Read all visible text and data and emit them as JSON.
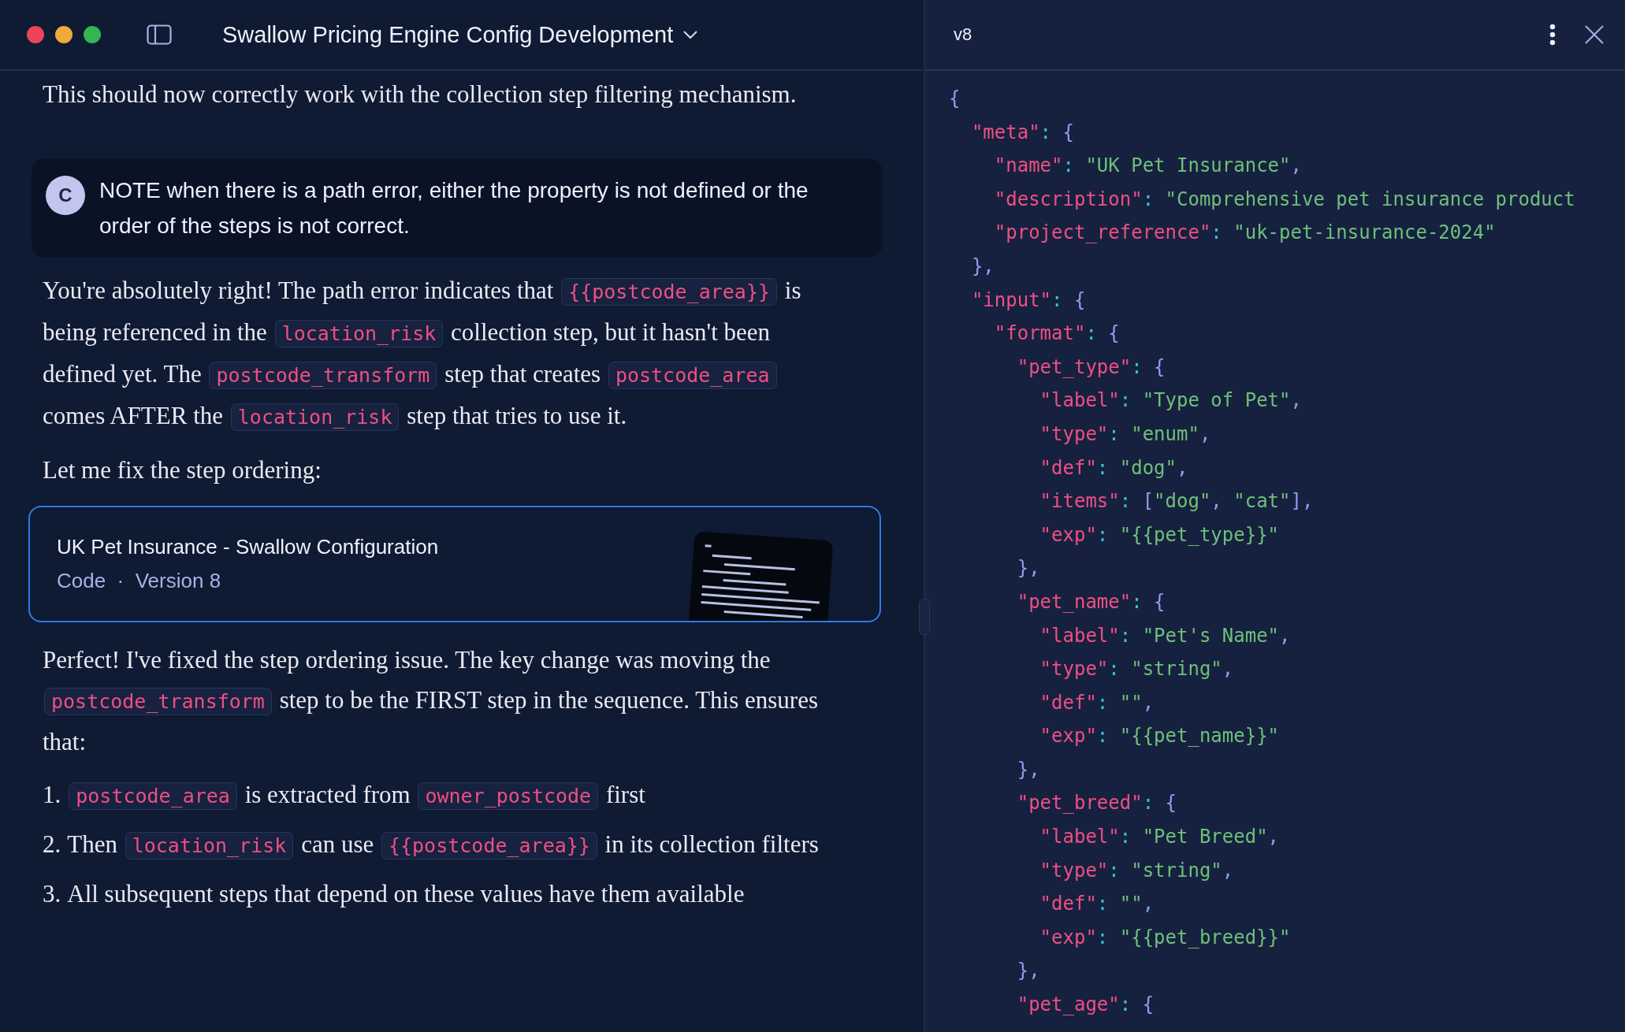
{
  "header": {
    "title": "Swallow Pricing Engine Config Development"
  },
  "chat": [
    {
      "kind": "paragraph",
      "parts": [
        {
          "kind": "text",
          "text": "This should now correctly work with the collection step filtering mechanism."
        }
      ]
    },
    {
      "kind": "note",
      "avatar": "C",
      "text": "NOTE when there is a path error, either the property is not defined or the order of the steps is not correct."
    },
    {
      "kind": "paragraph",
      "parts": [
        {
          "kind": "text",
          "text": "You're absolutely right! The path error indicates that "
        },
        {
          "kind": "code",
          "text": "{{postcode_area}}"
        },
        {
          "kind": "text",
          "text": " is being referenced in the "
        },
        {
          "kind": "code",
          "text": "location_risk"
        },
        {
          "kind": "text",
          "text": " collection step, but it hasn't been defined yet. The "
        },
        {
          "kind": "code",
          "text": "postcode_transform"
        },
        {
          "kind": "text",
          "text": " step that creates "
        },
        {
          "kind": "code",
          "text": "postcode_area"
        },
        {
          "kind": "text",
          "text": " comes AFTER the "
        },
        {
          "kind": "code",
          "text": "location_risk"
        },
        {
          "kind": "text",
          "text": " step that tries to use it."
        }
      ]
    },
    {
      "kind": "paragraph",
      "parts": [
        {
          "kind": "text",
          "text": "Let me fix the step ordering:"
        }
      ]
    },
    {
      "kind": "artifact",
      "title": "UK Pet Insurance - Swallow Configuration",
      "type": "Code",
      "separator": "·",
      "version": "Version 8"
    },
    {
      "kind": "paragraph",
      "parts": [
        {
          "kind": "text",
          "text": "Perfect! I've fixed the step ordering issue. The key change was moving the "
        },
        {
          "kind": "code",
          "text": "postcode_transform"
        },
        {
          "kind": "text",
          "text": " step to be the FIRST step in the sequence. This ensures that:"
        }
      ]
    },
    {
      "kind": "list",
      "items": [
        {
          "number": "1.",
          "parts": [
            {
              "kind": "code",
              "text": "postcode_area"
            },
            {
              "kind": "text",
              "text": " is extracted from "
            },
            {
              "kind": "code",
              "text": "owner_postcode"
            },
            {
              "kind": "text",
              "text": " first"
            }
          ]
        },
        {
          "number": "2.",
          "parts": [
            {
              "kind": "text",
              "text": "Then "
            },
            {
              "kind": "code",
              "text": "location_risk"
            },
            {
              "kind": "text",
              "text": " can use "
            },
            {
              "kind": "code",
              "text": "{{postcode_area}}"
            },
            {
              "kind": "text",
              "text": " in its collection filters"
            }
          ]
        },
        {
          "number": "3.",
          "parts": [
            {
              "kind": "text",
              "text": "All subsequent steps that depend on these values have them available"
            }
          ]
        }
      ]
    }
  ],
  "panel": {
    "version": "v8",
    "code_lines": [
      [
        {
          "kind": "punctuation",
          "text": "{"
        }
      ],
      [
        {
          "kind": "key",
          "text": "  \"meta\""
        },
        {
          "kind": "colon",
          "text": ": "
        },
        {
          "kind": "punctuation",
          "text": "{"
        }
      ],
      [
        {
          "kind": "key",
          "text": "    \"name\""
        },
        {
          "kind": "colon",
          "text": ": "
        },
        {
          "kind": "string",
          "text": "\"UK Pet Insurance\""
        },
        {
          "kind": "punctuation",
          "text": ","
        }
      ],
      [
        {
          "kind": "key",
          "text": "    \"description\""
        },
        {
          "kind": "colon",
          "text": ": "
        },
        {
          "kind": "string",
          "text": "\"Comprehensive pet insurance product"
        }
      ],
      [
        {
          "kind": "key",
          "text": "    \"project_reference\""
        },
        {
          "kind": "colon",
          "text": ": "
        },
        {
          "kind": "string",
          "text": "\"uk-pet-insurance-2024\""
        }
      ],
      [
        {
          "kind": "punctuation",
          "text": "  },"
        }
      ],
      [
        {
          "kind": "key",
          "text": "  \"input\""
        },
        {
          "kind": "colon",
          "text": ": "
        },
        {
          "kind": "punctuation",
          "text": "{"
        }
      ],
      [
        {
          "kind": "key",
          "text": "    \"format\""
        },
        {
          "kind": "colon",
          "text": ": "
        },
        {
          "kind": "punctuation",
          "text": "{"
        }
      ],
      [
        {
          "kind": "key",
          "text": "      \"pet_type\""
        },
        {
          "kind": "colon",
          "text": ": "
        },
        {
          "kind": "punctuation",
          "text": "{"
        }
      ],
      [
        {
          "kind": "key",
          "text": "        \"label\""
        },
        {
          "kind": "colon",
          "text": ": "
        },
        {
          "kind": "string",
          "text": "\"Type of Pet\""
        },
        {
          "kind": "punctuation",
          "text": ","
        }
      ],
      [
        {
          "kind": "key",
          "text": "        \"type\""
        },
        {
          "kind": "colon",
          "text": ": "
        },
        {
          "kind": "string",
          "text": "\"enum\""
        },
        {
          "kind": "punctuation",
          "text": ","
        }
      ],
      [
        {
          "kind": "key",
          "text": "        \"def\""
        },
        {
          "kind": "colon",
          "text": ": "
        },
        {
          "kind": "string",
          "text": "\"dog\""
        },
        {
          "kind": "punctuation",
          "text": ","
        }
      ],
      [
        {
          "kind": "key",
          "text": "        \"items\""
        },
        {
          "kind": "colon",
          "text": ": "
        },
        {
          "kind": "punctuation",
          "text": "["
        },
        {
          "kind": "string",
          "text": "\"dog\""
        },
        {
          "kind": "punctuation",
          "text": ", "
        },
        {
          "kind": "string",
          "text": "\"cat\""
        },
        {
          "kind": "punctuation",
          "text": "],"
        }
      ],
      [
        {
          "kind": "key",
          "text": "        \"exp\""
        },
        {
          "kind": "colon",
          "text": ": "
        },
        {
          "kind": "string",
          "text": "\"{{pet_type}}\""
        }
      ],
      [
        {
          "kind": "punctuation",
          "text": "      },"
        }
      ],
      [
        {
          "kind": "key",
          "text": "      \"pet_name\""
        },
        {
          "kind": "colon",
          "text": ": "
        },
        {
          "kind": "punctuation",
          "text": "{"
        }
      ],
      [
        {
          "kind": "key",
          "text": "        \"label\""
        },
        {
          "kind": "colon",
          "text": ": "
        },
        {
          "kind": "string",
          "text": "\"Pet's Name\""
        },
        {
          "kind": "punctuation",
          "text": ","
        }
      ],
      [
        {
          "kind": "key",
          "text": "        \"type\""
        },
        {
          "kind": "colon",
          "text": ": "
        },
        {
          "kind": "string",
          "text": "\"string\""
        },
        {
          "kind": "punctuation",
          "text": ","
        }
      ],
      [
        {
          "kind": "key",
          "text": "        \"def\""
        },
        {
          "kind": "colon",
          "text": ": "
        },
        {
          "kind": "string",
          "text": "\"\""
        },
        {
          "kind": "punctuation",
          "text": ","
        }
      ],
      [
        {
          "kind": "key",
          "text": "        \"exp\""
        },
        {
          "kind": "colon",
          "text": ": "
        },
        {
          "kind": "string",
          "text": "\"{{pet_name}}\""
        }
      ],
      [
        {
          "kind": "punctuation",
          "text": "      },"
        }
      ],
      [
        {
          "kind": "key",
          "text": "      \"pet_breed\""
        },
        {
          "kind": "colon",
          "text": ": "
        },
        {
          "kind": "punctuation",
          "text": "{"
        }
      ],
      [
        {
          "kind": "key",
          "text": "        \"label\""
        },
        {
          "kind": "colon",
          "text": ": "
        },
        {
          "kind": "string",
          "text": "\"Pet Breed\""
        },
        {
          "kind": "punctuation",
          "text": ","
        }
      ],
      [
        {
          "kind": "key",
          "text": "        \"type\""
        },
        {
          "kind": "colon",
          "text": ": "
        },
        {
          "kind": "string",
          "text": "\"string\""
        },
        {
          "kind": "punctuation",
          "text": ","
        }
      ],
      [
        {
          "kind": "key",
          "text": "        \"def\""
        },
        {
          "kind": "colon",
          "text": ": "
        },
        {
          "kind": "string",
          "text": "\"\""
        },
        {
          "kind": "punctuation",
          "text": ","
        }
      ],
      [
        {
          "kind": "key",
          "text": "        \"exp\""
        },
        {
          "kind": "colon",
          "text": ": "
        },
        {
          "kind": "string",
          "text": "\"{{pet_breed}}\""
        }
      ],
      [
        {
          "kind": "punctuation",
          "text": "      },"
        }
      ],
      [
        {
          "kind": "key",
          "text": "      \"pet_age\""
        },
        {
          "kind": "colon",
          "text": ": "
        },
        {
          "kind": "punctuation",
          "text": "{"
        }
      ]
    ]
  }
}
